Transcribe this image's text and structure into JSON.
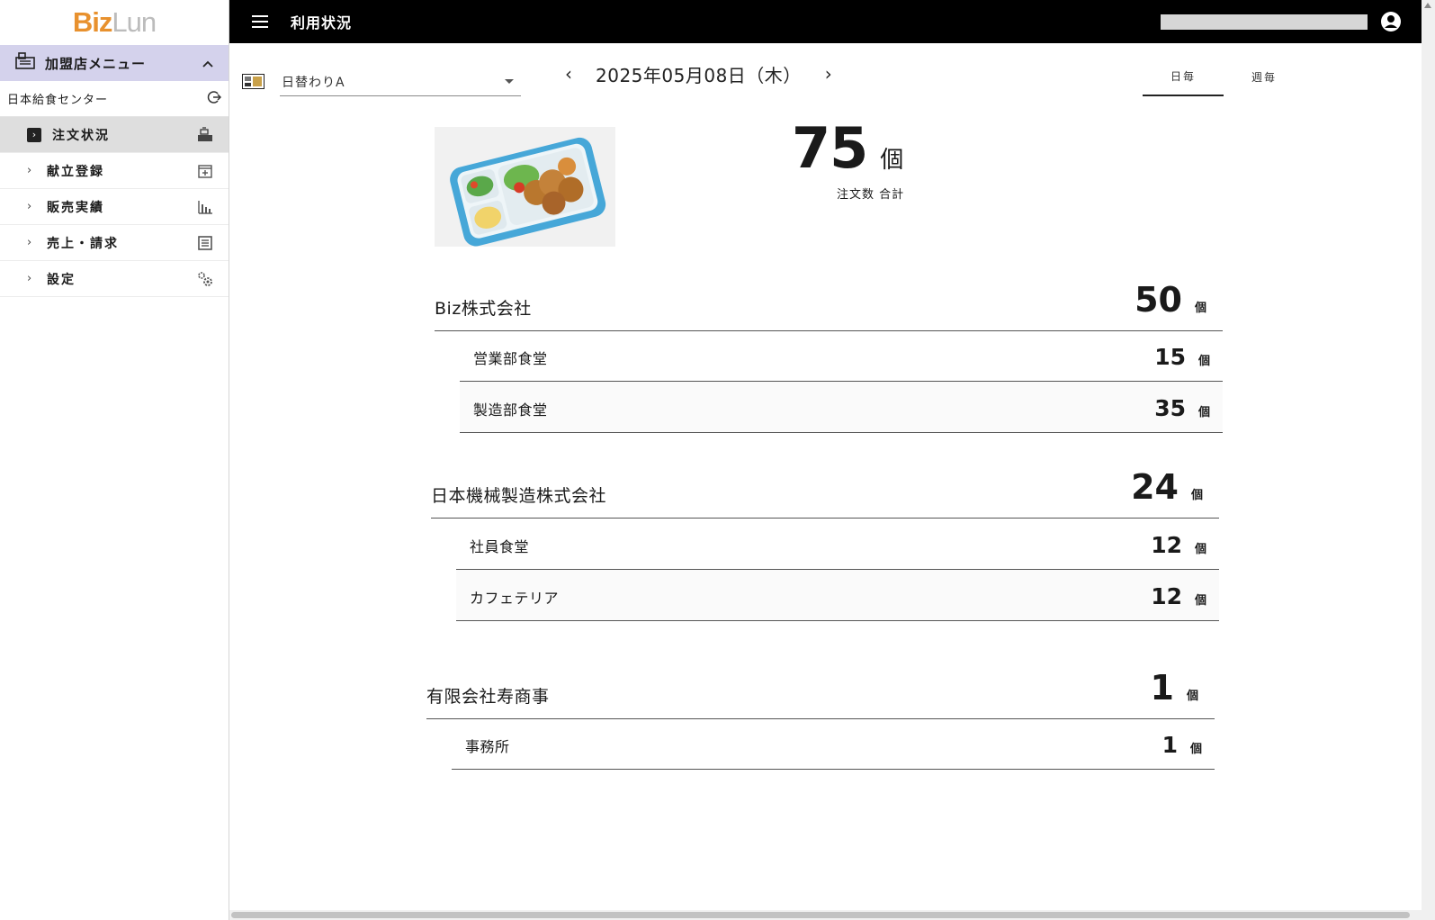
{
  "app": {
    "logo_part1": "Biz",
    "logo_part2": "Lun",
    "page_title": "利用状況"
  },
  "sidebar": {
    "menu_header": "加盟店メニュー",
    "shop_name": "日本給食センター",
    "items": [
      {
        "label": "注文状況",
        "active": true,
        "icon": "cash-register-icon"
      },
      {
        "label": "献立登録",
        "active": false,
        "icon": "calendar-plus-icon"
      },
      {
        "label": "販売実績",
        "active": false,
        "icon": "bar-chart-icon"
      },
      {
        "label": "売上・請求",
        "active": false,
        "icon": "document-list-icon"
      },
      {
        "label": "設定",
        "active": false,
        "icon": "gears-icon"
      }
    ]
  },
  "toolbar": {
    "menu_select_value": "日替わりA",
    "date": "2025年05月08日（木）",
    "tabs": [
      {
        "label": "日毎",
        "active": true
      },
      {
        "label": "週毎",
        "active": false
      }
    ]
  },
  "summary": {
    "total": "75",
    "unit": "個",
    "total_label": "注文数 合計"
  },
  "companies": [
    {
      "name": "Biz株式会社",
      "qty": "50",
      "unit": "個",
      "locations": [
        {
          "name": "営業部食堂",
          "qty": "15",
          "unit": "個"
        },
        {
          "name": "製造部食堂",
          "qty": "35",
          "unit": "個"
        }
      ]
    },
    {
      "name": "日本機械製造株式会社",
      "qty": "24",
      "unit": "個",
      "locations": [
        {
          "name": "社員食堂",
          "qty": "12",
          "unit": "個"
        },
        {
          "name": "カフェテリア",
          "qty": "12",
          "unit": "個"
        }
      ]
    },
    {
      "name": "有限会社寿商事",
      "qty": "1",
      "unit": "個",
      "locations": [
        {
          "name": "事務所",
          "qty": "1",
          "unit": "個"
        }
      ]
    }
  ]
}
